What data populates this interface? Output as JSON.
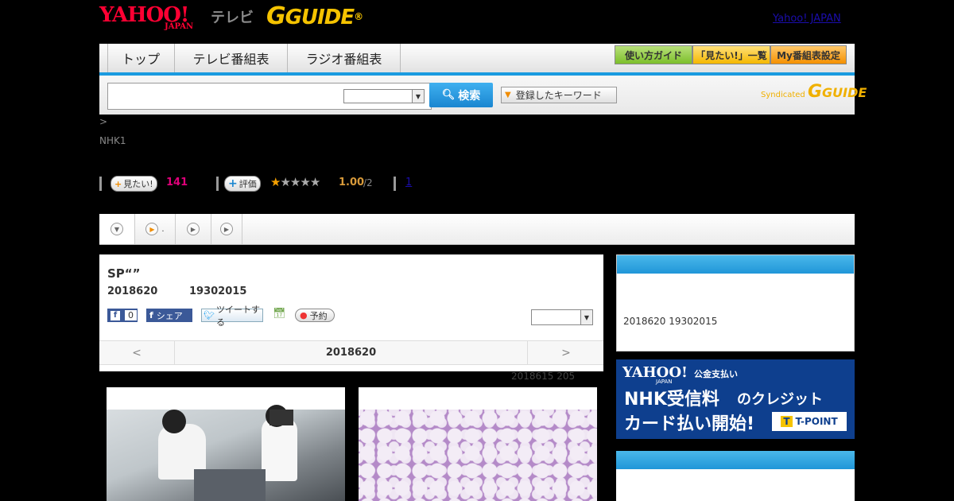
{
  "header": {
    "yahoo_logo": "YAHOO!",
    "japan_logo": "JAPAN",
    "tv_label": "テレビ",
    "gguide_logo": "GUIDE",
    "yahoo_japan_link": "Yahoo! JAPAN"
  },
  "nav": {
    "tabs": [
      "トップ",
      "テレビ番組表",
      "ラジオ番組表"
    ],
    "right_buttons": [
      "使い方ガイド",
      "「見たい!」一覧",
      "My番組表設定"
    ]
  },
  "search": {
    "input_value": "",
    "select_value": "",
    "button_label": "検索",
    "keyword_button": "登録したキーワード",
    "syndicated_label": "Syndicated",
    "syndicated_logo": "GUIDE"
  },
  "info": {
    "breadcrumb": ">",
    "channel": "NHK1",
    "mitai_label": "見たい!",
    "mitai_count": "141",
    "hyoka_label": "評価",
    "rating_value": "1.00",
    "rating_count": "/2",
    "review_link": "1",
    "rating_stars": 1
  },
  "program": {
    "title": "SP“”",
    "date": "2018620",
    "time": "19302015",
    "fb_count": "0",
    "share_label": "シェア",
    "tweet_label": "ツイートする",
    "reserve_label": "予約",
    "date_nav_prev": "<",
    "date_nav_current": "2018620",
    "date_nav_next": ">",
    "meta": "2018615  205"
  },
  "sidebar": {
    "info_text": "2018620  19302015",
    "ad_line1": "公金支払い",
    "ad_line2": "NHK受信料",
    "ad_line2b": "のクレジット",
    "ad_line3": "カード払い開始!",
    "ad_tpoint": "T-POINT",
    "ad_yahoo": "YAHOO!",
    "ad_japan": "JAPAN"
  }
}
